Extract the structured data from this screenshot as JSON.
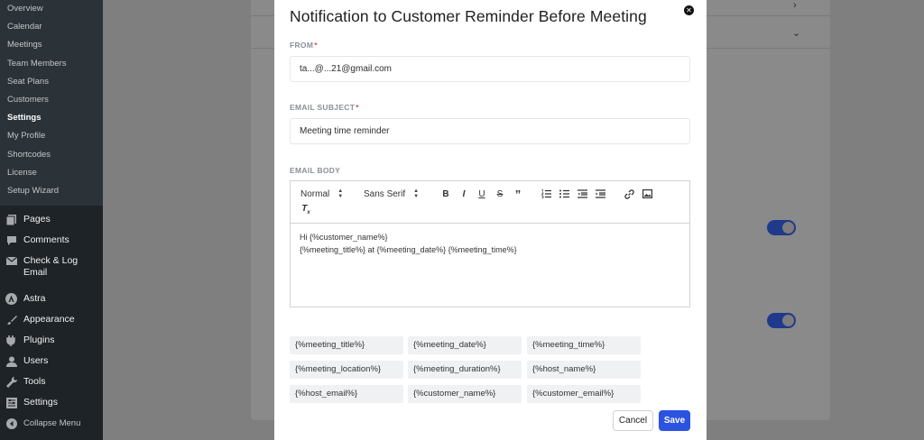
{
  "sidebar": {
    "submenu": [
      "Overview",
      "Calendar",
      "Meetings",
      "Team Members",
      "Seat Plans",
      "Customers",
      "Settings",
      "My Profile",
      "Shortcodes",
      "License",
      "Setup Wizard"
    ],
    "current": "Settings",
    "menu": [
      {
        "label": "Pages",
        "icon": "pages-icon"
      },
      {
        "label": "Comments",
        "icon": "comments-icon"
      },
      {
        "label": "Check & Log Email",
        "icon": "email-log-icon"
      },
      {
        "label": "Astra",
        "icon": "astra-icon"
      },
      {
        "label": "Appearance",
        "icon": "appearance-icon"
      },
      {
        "label": "Plugins",
        "icon": "plugins-icon"
      },
      {
        "label": "Users",
        "icon": "users-icon"
      },
      {
        "label": "Tools",
        "icon": "tools-icon"
      },
      {
        "label": "Settings",
        "icon": "settings-icon"
      }
    ],
    "collapse_label": "Collapse Menu"
  },
  "modal": {
    "title": "Notification to Customer Reminder Before Meeting",
    "from": {
      "label": "FROM",
      "value": "ta...@...21@gmail.com"
    },
    "subject": {
      "label": "EMAIL SUBJECT",
      "value": "Meeting time reminder"
    },
    "body": {
      "label": "EMAIL BODY",
      "toolbar": {
        "format": "Normal",
        "font": "Sans Serif"
      },
      "lines": [
        "Hi {%customer_name%}",
        "{%meeting_title%} at {%meeting_date%} {%meeting_time%}"
      ]
    },
    "tags": [
      "{%meeting_title%}",
      "{%meeting_date%}",
      "{%meeting_time%}",
      "{%meeting_location%}",
      "{%meeting_duration%}",
      "{%host_name%}",
      "{%host_email%}",
      "{%customer_name%}",
      "{%customer_email%}"
    ],
    "cancel_label": "Cancel",
    "save_label": "Save"
  },
  "colors": {
    "primary": "#2b53e0",
    "required": "#e24a4a",
    "sidebar": "#1d2327"
  }
}
